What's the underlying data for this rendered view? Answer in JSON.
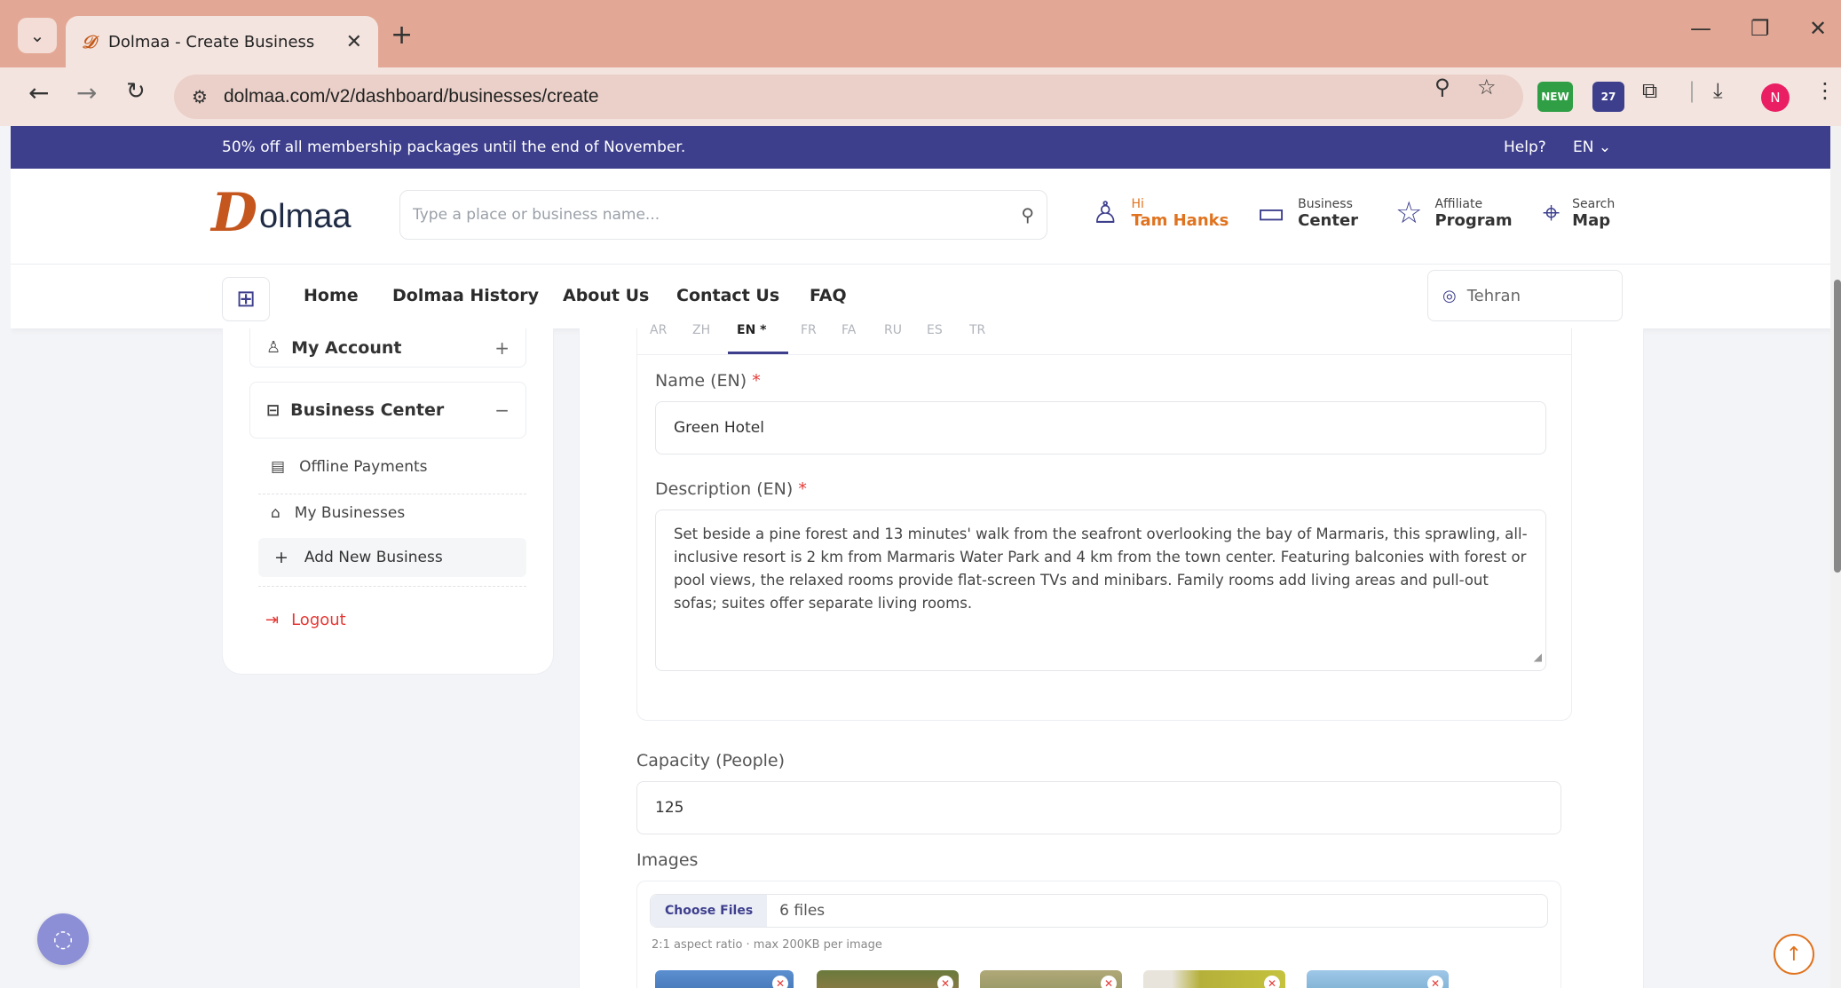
{
  "browser": {
    "tab_title": "Dolmaa - Create Business",
    "tab_close": "✕",
    "new_tab": "+",
    "url": "dolmaa.com/v2/dashboard/businesses/create",
    "ext_new_badge": "NEW",
    "ext_badge_count": "27",
    "profile_initial": "N"
  },
  "promo": {
    "message": "50% off all membership packages until the end of November.",
    "help": "Help?",
    "language": "EN ⌄"
  },
  "header": {
    "logo_letter": "D",
    "logo_rest": "olmaa",
    "search_placeholder": "Type a place or business name...",
    "user_greeting": "Hi",
    "user_name": "Tam Hanks",
    "business_small": "Business",
    "business_big": "Center",
    "affiliate_small": "Affiliate",
    "affiliate_big": "Program",
    "map_small": "Search",
    "map_big": "Map"
  },
  "nav": {
    "links": [
      "Home",
      "Dolmaa History",
      "About Us",
      "Contact Us",
      "FAQ"
    ],
    "location": "Tehran"
  },
  "sidebar": {
    "my_account": "My Account",
    "my_account_toggle": "+",
    "business_center": "Business Center",
    "business_center_toggle": "−",
    "offline_payments": "Offline Payments",
    "my_businesses": "My Businesses",
    "add_new_business": "Add New Business",
    "logout": "Logout"
  },
  "form": {
    "lang_tabs": [
      "AR",
      "ZH",
      "EN *",
      "FR",
      "FA",
      "RU",
      "ES",
      "TR"
    ],
    "name_label": "Name (EN)",
    "name_value": "Green Hotel",
    "description_label": "Description (EN)",
    "description_value": "Set beside a pine forest and 13 minutes' walk from the seafront overlooking the bay of Marmaris, this sprawling, all-inclusive resort is 2 km from Marmaris Water Park and 4 km from the town center. Featuring balconies with forest or pool views, the relaxed rooms provide flat-screen TVs and minibars. Family rooms add living areas and pull-out sofas; suites offer separate living rooms.",
    "required_mark": "*",
    "capacity_label": "Capacity (People)",
    "capacity_value": "125",
    "images_label": "Images",
    "choose_files": "Choose Files",
    "file_count": "6 files",
    "images_hint": "2:1 aspect ratio · max 200KB per image"
  },
  "colors": {
    "brand_navy": "#3d3f8d",
    "brand_orange": "#e0731f",
    "danger": "#e53935"
  }
}
